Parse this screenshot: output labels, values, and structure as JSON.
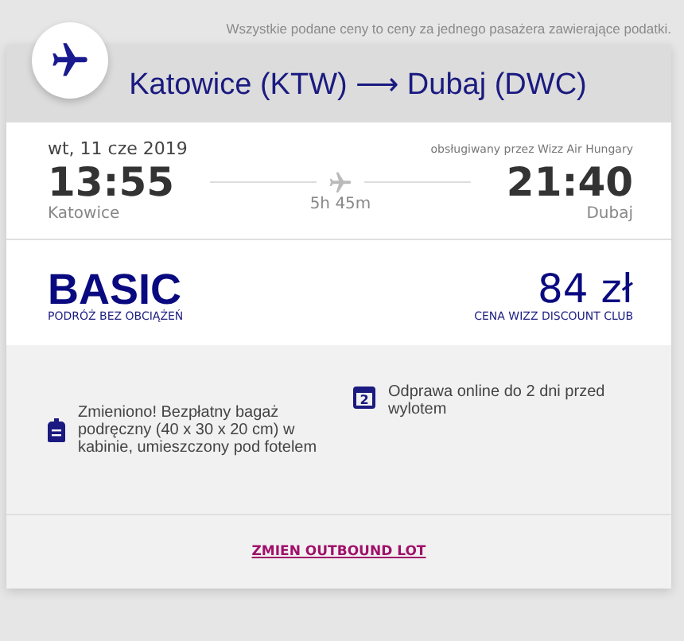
{
  "notice": "Wszystkie podane ceny to ceny za jednego pasażera zawierające podatki.",
  "route": {
    "origin": "Katowice (KTW)",
    "arrow": "⟶",
    "destination": "Dubaj (DWC)"
  },
  "flight": {
    "date": "wt, 11 cze 2019",
    "operator": "obsługiwany przez Wizz Air Hungary",
    "departure_time": "13:55",
    "departure_city": "Katowice",
    "duration": "5h 45m",
    "arrival_time": "21:40",
    "arrival_city": "Dubaj"
  },
  "fare": {
    "name": "BASIC",
    "subtitle": "PODRÓŻ BEZ OBCIĄŻEŃ",
    "price": "84 zł",
    "price_note": "CENA WIZZ DISCOUNT CLUB"
  },
  "features": [
    {
      "kind": "bag",
      "text": "Zmieniono! Bezpłatny bagaż podręczny (40 x 30 x 20 cm) w kabinie, umieszczony pod fotelem"
    },
    {
      "kind": "calendar",
      "day": "2",
      "text": "Odprawa online do 2 dni przed wylotem"
    }
  ],
  "change_link": "ZMIEN OUTBOUND LOT"
}
